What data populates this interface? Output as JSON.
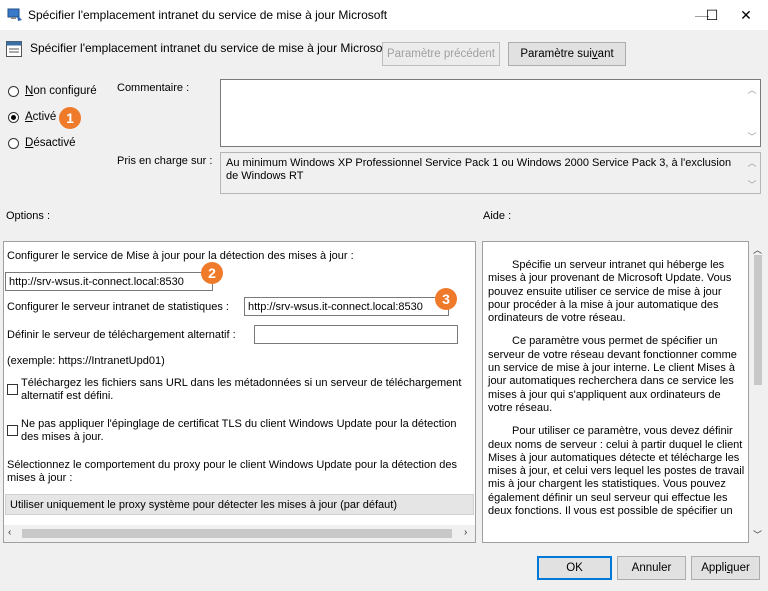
{
  "window": {
    "title": "Spécifier l'emplacement intranet du service de mise à jour Microsoft",
    "controls": {
      "minimize": "—",
      "maximize": "☐",
      "close": "✕"
    }
  },
  "header": {
    "policy_title": "Spécifier l'emplacement intranet du service de mise à jour Microsoft",
    "prev_button": "Paramètre précédent",
    "next_button_pre": "Paramètre sui",
    "next_button_u": "v",
    "next_button_post": "ant"
  },
  "state": {
    "options": [
      {
        "u": "N",
        "rest": "on configuré",
        "selected": false
      },
      {
        "u": "A",
        "rest": "ctivé",
        "selected": true
      },
      {
        "u": "D",
        "rest": "ésactivé",
        "selected": false
      }
    ]
  },
  "comment": {
    "label": "Commentaire :",
    "value": ""
  },
  "supported": {
    "label": "Pris en charge sur :",
    "value": "Au minimum Windows XP Professionnel Service Pack 1 ou Windows 2000 Service Pack 3, à l'exclusion de Windows RT"
  },
  "options_section": {
    "label": "Options :",
    "detect_label": "Configurer le service de Mise à jour pour la détection des mises à jour :",
    "detect_value": "http://srv-wsus.it-connect.local:8530",
    "stats_label": "Configurer le serveur intranet de statistiques :",
    "stats_value": "http://srv-wsus.it-connect.local:8530",
    "alt_label": "Définir le serveur de téléchargement alternatif :",
    "alt_value": "",
    "example": "(exemple: https://IntranetUpd01)",
    "check1": "Téléchargez les fichiers sans URL dans les métadonnées si un serveur de téléchargement alternatif est défini.",
    "check2": "Ne pas appliquer l'épinglage de certificat TLS du client Windows Update pour la détection des mises à jour.",
    "proxy_label": "Sélectionnez le comportement du proxy pour le client Windows Update pour la détection des mises à jour :",
    "proxy_value": "Utiliser uniquement le proxy système pour détecter les mises à jour (par défaut)"
  },
  "help_section": {
    "label": "Aide :",
    "paragraphs": [
      "Spécifie un serveur intranet qui héberge les mises à jour provenant de Microsoft Update. Vous pouvez ensuite utiliser ce service de mise à jour pour procéder à la mise à jour automatique des ordinateurs de votre réseau.",
      "Ce paramètre vous permet de spécifier un serveur de votre réseau devant fonctionner comme un service de mise à jour interne. Le client Mises à jour automatiques recherchera dans ce service les mises à jour qui s'appliquent aux ordinateurs de votre réseau.",
      "Pour utiliser ce paramètre, vous devez définir deux noms de serveur : celui à partir duquel le client Mises à jour automatiques détecte et télécharge les mises à jour, et celui vers lequel les postes de travail mis à jour chargent les statistiques. Vous pouvez également définir un seul serveur qui effectue les deux fonctions. Il vous est possible de spécifier un"
    ]
  },
  "badges": [
    "1",
    "2",
    "3"
  ],
  "footer": {
    "ok": "OK",
    "cancel": "Annuler",
    "apply_pre": "Appli",
    "apply_u": "q",
    "apply_post": "uer"
  },
  "colors": {
    "badge": "#ef7a2a",
    "focus": "#0078d7"
  }
}
